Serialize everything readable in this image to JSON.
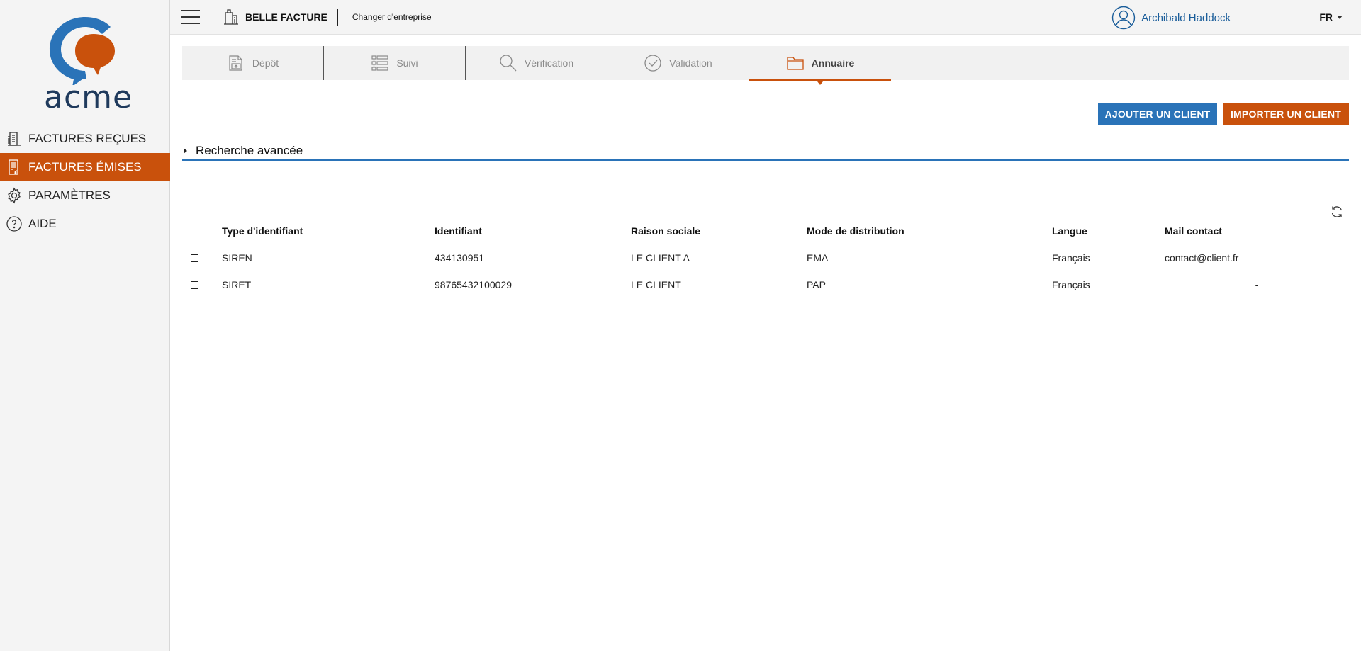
{
  "brand": {
    "name": "acme",
    "colors": {
      "orange": "#c9510c",
      "blue": "#2a73b8",
      "navy": "#1f3a5c"
    }
  },
  "sidebar": {
    "items": [
      {
        "label": "FACTURES REÇUES",
        "icon": "received-invoices-icon",
        "active": false
      },
      {
        "label": "FACTURES ÉMISES",
        "icon": "issued-invoices-icon",
        "active": true
      },
      {
        "label": "PARAMÈTRES",
        "icon": "gear-icon",
        "active": false
      },
      {
        "label": "AIDE",
        "icon": "help-icon",
        "active": false
      }
    ]
  },
  "topbar": {
    "company_name": "BELLE FACTURE",
    "change_company": "Changer d'entreprise",
    "user_name": "Archibald Haddock",
    "language": "FR"
  },
  "tabs": [
    {
      "label": "Dépôt",
      "icon": "upload-document-icon",
      "active": false
    },
    {
      "label": "Suivi",
      "icon": "list-icon",
      "active": false
    },
    {
      "label": "Vérification",
      "icon": "search-icon",
      "active": false
    },
    {
      "label": "Validation",
      "icon": "check-circle-icon",
      "active": false
    },
    {
      "label": "Annuaire",
      "icon": "folder-icon",
      "active": true
    }
  ],
  "actions": {
    "add_client": "AJOUTER UN CLIENT",
    "import_client": "IMPORTER UN CLIENT"
  },
  "advanced_search": {
    "label": "Recherche avancée"
  },
  "table": {
    "headers": {
      "type": "Type d'identifiant",
      "identifier": "Identifiant",
      "company": "Raison sociale",
      "distribution": "Mode de distribution",
      "language": "Langue",
      "mail": "Mail contact"
    },
    "rows": [
      {
        "type": "SIREN",
        "identifier": "434130951",
        "company": "LE CLIENT A",
        "distribution": "EMA",
        "language": "Français",
        "mail": "contact@client.fr"
      },
      {
        "type": "SIRET",
        "identifier": "98765432100029",
        "company": "LE CLIENT",
        "distribution": "PAP",
        "language": "Français",
        "mail": "-"
      }
    ]
  }
}
